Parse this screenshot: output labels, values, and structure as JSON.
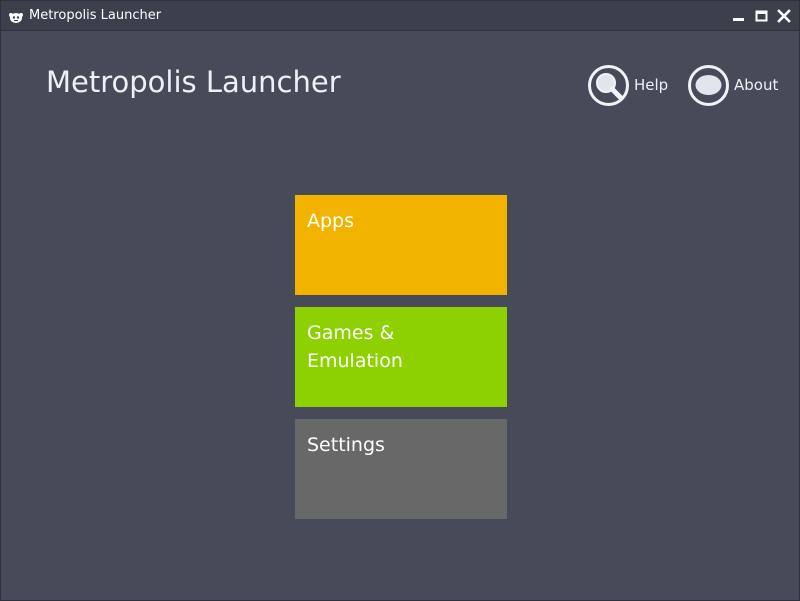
{
  "window": {
    "title": "Metropolis Launcher"
  },
  "header": {
    "title": "Metropolis Launcher",
    "help_label": "Help",
    "about_label": "About"
  },
  "tiles": [
    {
      "label": "Apps",
      "color": "#f2b200"
    },
    {
      "label": "Games & Emulation",
      "color": "#8ed100"
    },
    {
      "label": "Settings",
      "color": "#686868"
    }
  ],
  "colors": {
    "background": "#474a58",
    "titlebar": "#3c3f4c",
    "text": "#eef0f6"
  },
  "icons": {
    "app": "monkey-icon",
    "help": "magnifier-icon",
    "about": "speech-bubble-icon",
    "minimize": "minimize-icon",
    "maximize": "maximize-icon",
    "close": "close-icon"
  }
}
